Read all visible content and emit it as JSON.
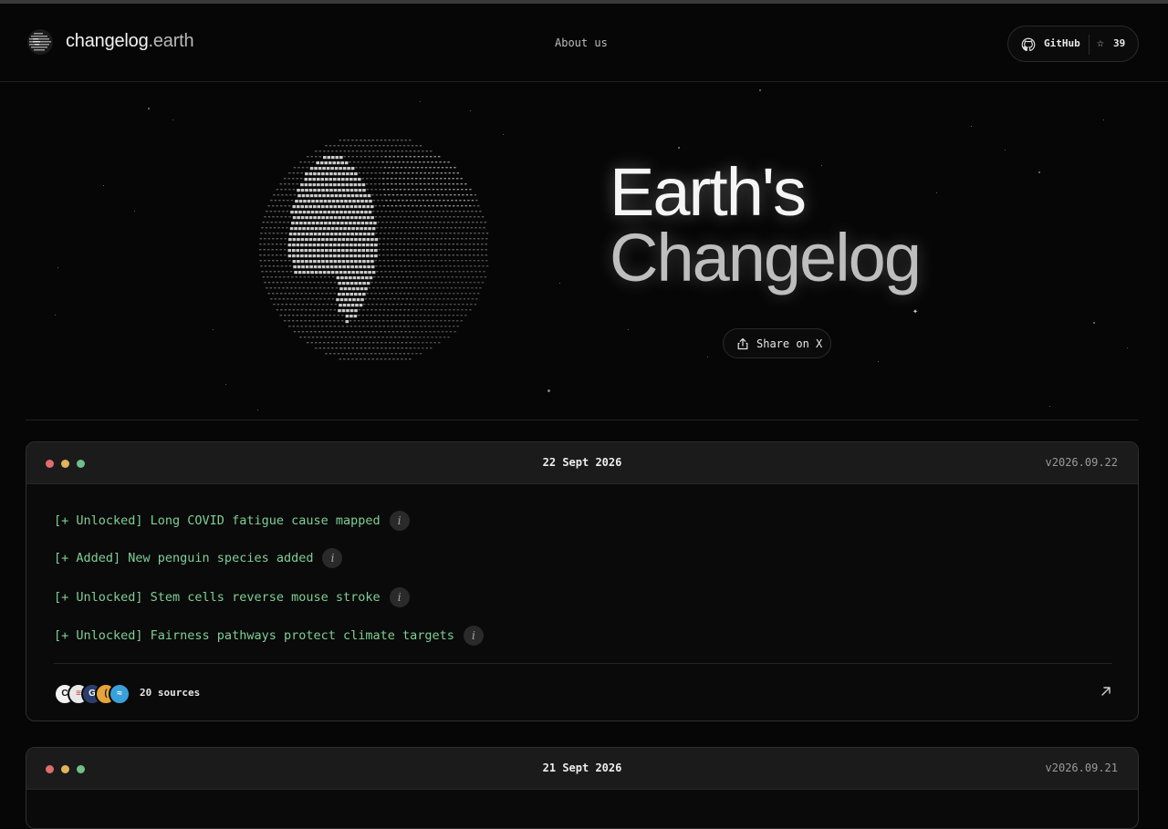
{
  "header": {
    "brand_main": "changelog",
    "brand_tld": ".earth",
    "nav_about": "About us",
    "github_label": "GitHub",
    "star_count": "39"
  },
  "hero": {
    "title_line1": "Earth's",
    "title_line2": "Changelog",
    "share_label": "Share on X"
  },
  "entries": [
    {
      "date": "22 Sept 2026",
      "version": "v2026.09.22",
      "items": [
        "[+ Unlocked] Long COVID fatigue cause mapped",
        "[+ Added] New penguin species added",
        "[+ Unlocked] Stem cells reverse mouse stroke",
        "[+ Unlocked] Fairness pathways protect climate targets"
      ],
      "sources_label": "20 sources"
    },
    {
      "date": "21 Sept 2026",
      "version": "v2026.09.21"
    }
  ],
  "icons": {
    "info": "i",
    "star": "☆",
    "sparkle": "✦"
  },
  "colors": {
    "accent_green": "#7fcf95",
    "dot_red": "#e06c6c",
    "dot_yellow": "#e2b35a",
    "dot_green": "#6fbf8a"
  }
}
